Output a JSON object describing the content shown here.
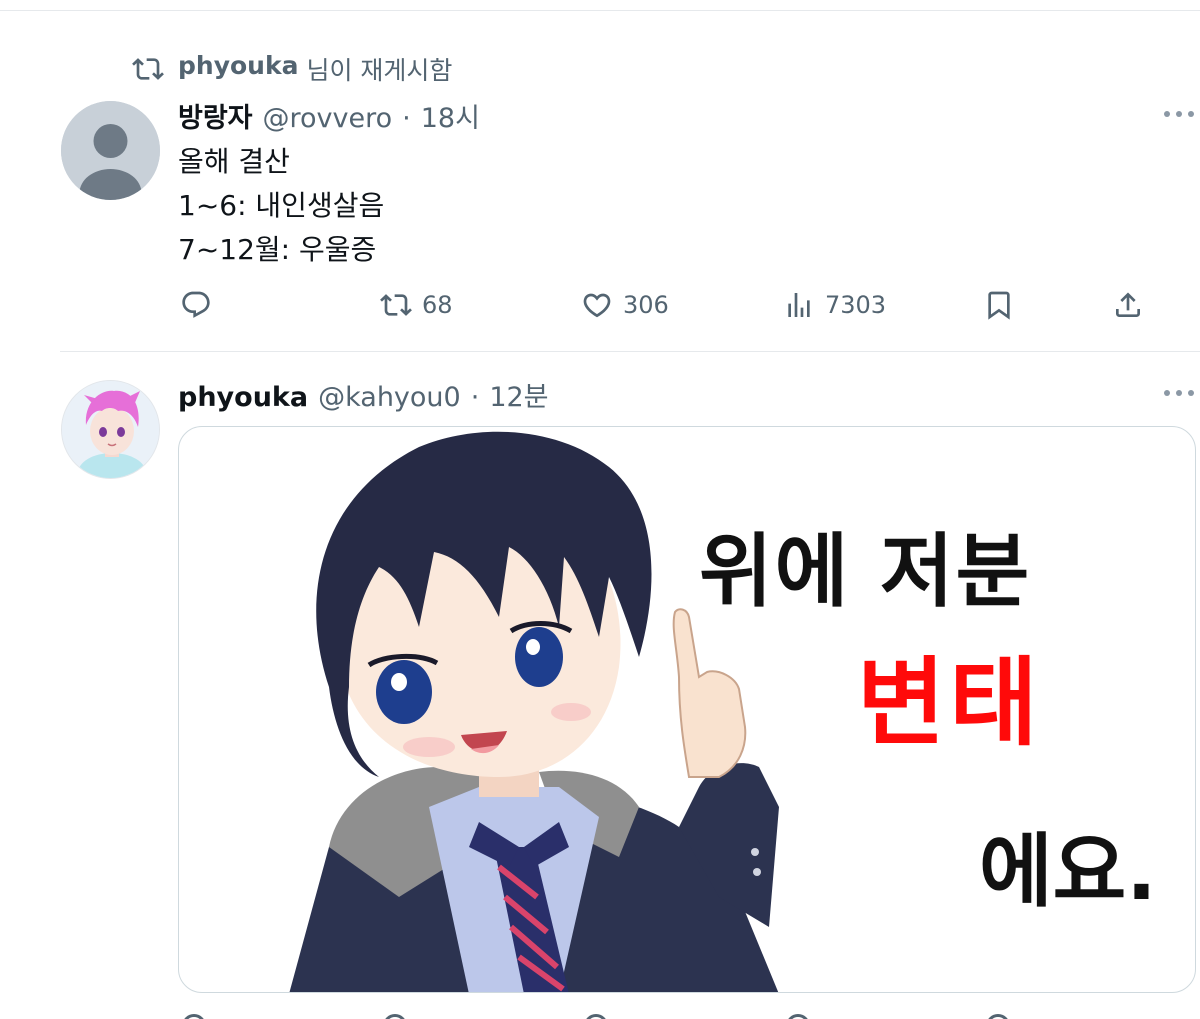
{
  "retweet_context": {
    "name": "phyouka",
    "text": "님이 재게시함"
  },
  "tweet1": {
    "display_name": "방랑자",
    "handle": "@rovvero",
    "separator": "·",
    "time": "18시",
    "lines": [
      "올해 결산",
      "1~6: 내인생살음",
      "7~12월: 우울증"
    ],
    "actions": {
      "replies": "",
      "reposts": "68",
      "likes": "306",
      "views": "7303"
    }
  },
  "tweet2": {
    "display_name": "phyouka",
    "handle": "@kahyou0",
    "separator": "·",
    "time": "12분",
    "media": {
      "line1": "위에 저분",
      "line2": "변태",
      "line3": "에요."
    }
  },
  "colors": {
    "text_primary": "#0f1419",
    "text_secondary": "#536471",
    "divider": "#e6e9ec",
    "meme_red": "#ff0a0a"
  },
  "icons": [
    "repost-icon",
    "reply-icon",
    "like-icon",
    "views-icon",
    "bookmark-icon",
    "share-icon",
    "more-icon"
  ]
}
